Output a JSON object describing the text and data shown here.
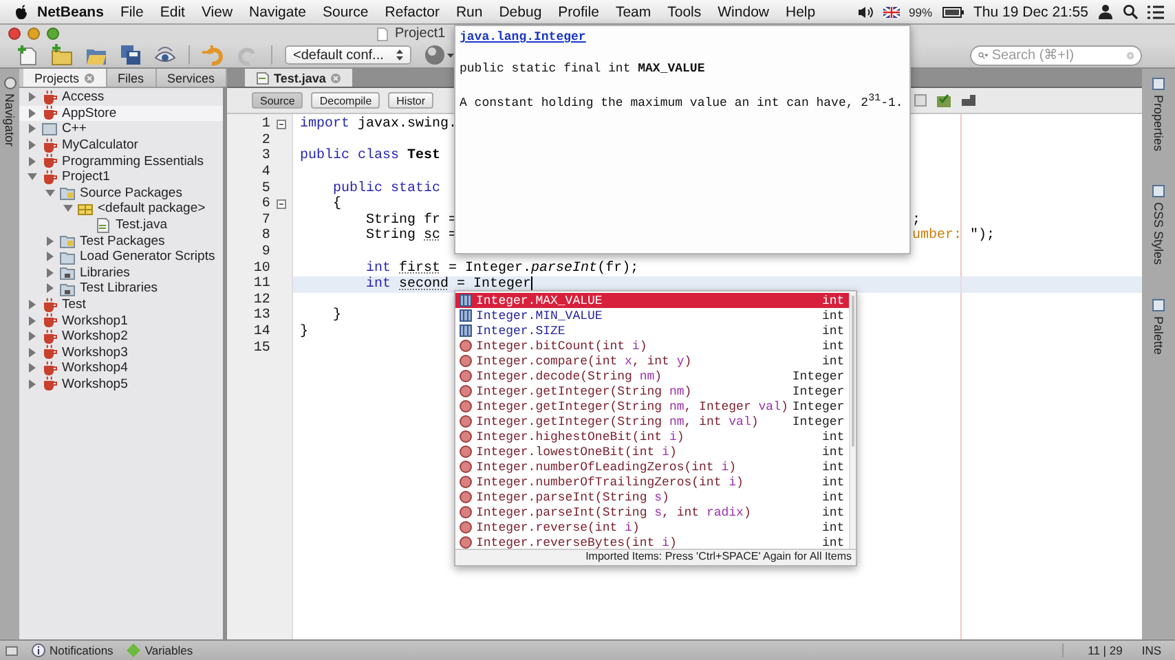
{
  "menu_bar": {
    "app": "NetBeans",
    "items": [
      "File",
      "Edit",
      "View",
      "Navigate",
      "Source",
      "Refactor",
      "Run",
      "Debug",
      "Profile",
      "Team",
      "Tools",
      "Window",
      "Help"
    ],
    "battery": "99%",
    "clock": "Thu 19 Dec  21:55"
  },
  "window": {
    "title": "Project1"
  },
  "toolbar": {
    "config": "<default conf...",
    "search": {
      "placeholder": "Search (⌘+I)"
    }
  },
  "side_strips": {
    "left": [
      "Navigator"
    ],
    "right": [
      "Properties",
      "CSS Styles",
      "Palette"
    ]
  },
  "projects_panel": {
    "tabs": [
      {
        "label": "Projects",
        "selected": true
      },
      {
        "label": "Files",
        "selected": false
      },
      {
        "label": "Services",
        "selected": false
      }
    ],
    "tree": [
      {
        "kind": "project",
        "label": "Access",
        "expanded": false,
        "selected": false
      },
      {
        "kind": "project",
        "label": "AppStore",
        "expanded": false,
        "selected": true
      },
      {
        "kind": "cpp",
        "label": "C++",
        "expanded": false,
        "selected": false
      },
      {
        "kind": "project",
        "label": "MyCalculator",
        "expanded": false,
        "selected": false
      },
      {
        "kind": "project",
        "label": "Programming Essentials",
        "expanded": false,
        "selected": false
      },
      {
        "kind": "project",
        "label": "Project1",
        "expanded": true,
        "selected": false,
        "children": [
          {
            "kind": "source",
            "label": "Source Packages",
            "expanded": true,
            "selected": false,
            "children": [
              {
                "kind": "package",
                "label": "<default package>",
                "expanded": true,
                "selected": false,
                "children": [
                  {
                    "kind": "java",
                    "label": "Test.java",
                    "selected": false
                  }
                ]
              }
            ]
          },
          {
            "kind": "source",
            "label": "Test Packages",
            "expanded": false,
            "selected": false
          },
          {
            "kind": "folder",
            "label": "Load Generator Scripts",
            "expanded": false,
            "selected": false
          },
          {
            "kind": "library",
            "label": "Libraries",
            "expanded": false,
            "selected": false
          },
          {
            "kind": "library",
            "label": "Test Libraries",
            "expanded": false,
            "selected": false
          }
        ]
      },
      {
        "kind": "project",
        "label": "Test",
        "expanded": false,
        "selected": false
      },
      {
        "kind": "project",
        "label": "Workshop1",
        "expanded": false,
        "selected": false
      },
      {
        "kind": "project",
        "label": "Workshop2",
        "expanded": false,
        "selected": false
      },
      {
        "kind": "project",
        "label": "Workshop3",
        "expanded": false,
        "selected": false
      },
      {
        "kind": "project",
        "label": "Workshop4",
        "expanded": false,
        "selected": false
      },
      {
        "kind": "project",
        "label": "Workshop5",
        "expanded": false,
        "selected": false
      }
    ]
  },
  "editor": {
    "tabs": [
      {
        "label": "Test.java",
        "selected": true
      }
    ],
    "views": [
      {
        "label": "Source",
        "selected": true
      },
      {
        "label": "Decompile",
        "selected": false
      },
      {
        "label": "Histor",
        "selected": false
      }
    ],
    "lines": [
      {
        "number": "1",
        "fold": true,
        "current": false,
        "parts": [
          {
            "kind": "kw",
            "text": "import"
          },
          {
            "kind": "plain",
            "text": " javax.swing."
          }
        ]
      },
      {
        "number": "2",
        "fold": false,
        "current": false
      },
      {
        "number": "3",
        "fold": false,
        "current": false,
        "parts": [
          {
            "kind": "kw",
            "text": "public class "
          },
          {
            "kind": "bold",
            "text": "Test"
          }
        ]
      },
      {
        "number": "4",
        "fold": false,
        "current": false
      },
      {
        "number": "5",
        "fold": false,
        "current": false,
        "parts": [
          {
            "kind": "kw",
            "text": "    public static"
          }
        ]
      },
      {
        "number": "6",
        "fold": true,
        "current": false,
        "parts": [
          {
            "kind": "plain",
            "text": "    {"
          }
        ]
      },
      {
        "number": "7",
        "fold": false,
        "current": false,
        "parts": [
          {
            "kind": "plain",
            "text": "        String fr ="
          }
        ],
        "tail": [
          {
            "kind": "plain",
            "text": ";"
          }
        ]
      },
      {
        "number": "8",
        "fold": false,
        "current": false,
        "parts": [
          {
            "kind": "plain",
            "text": "        String "
          },
          {
            "kind": "ul",
            "text": "sc"
          },
          {
            "kind": "plain",
            "text": " ="
          }
        ],
        "tail": [
          {
            "kind": "str",
            "text": "umber: "
          },
          {
            "kind": "plain",
            "text": "\");"
          }
        ]
      },
      {
        "number": "9",
        "fold": false,
        "current": false
      },
      {
        "number": "10",
        "fold": false,
        "current": false,
        "parts": [
          {
            "kind": "kw",
            "text": "        int "
          },
          {
            "kind": "ul",
            "text": "first"
          },
          {
            "kind": "plain",
            "text": " = Integer."
          },
          {
            "kind": "ital",
            "text": "parseInt"
          },
          {
            "kind": "plain",
            "text": "(fr);"
          }
        ]
      },
      {
        "number": "11",
        "fold": false,
        "current": true,
        "parts": [
          {
            "kind": "kw",
            "text": "        int "
          },
          {
            "kind": "ul",
            "text": "second"
          },
          {
            "kind": "plain",
            "text": " = Integer"
          }
        ]
      },
      {
        "number": "12",
        "fold": false,
        "current": false
      },
      {
        "number": "13",
        "fold": false,
        "current": false,
        "parts": [
          {
            "kind": "plain",
            "text": "    }"
          }
        ]
      },
      {
        "number": "14",
        "fold": false,
        "current": false,
        "parts": [
          {
            "kind": "plain",
            "text": "}"
          }
        ]
      },
      {
        "number": "15",
        "fold": false,
        "current": false
      }
    ]
  },
  "doc_popup": {
    "class_link": "java.lang.Integer",
    "signature": "public static final int **MAX_VALUE**",
    "description": "A constant holding the maximum value an int can have, 2$^{31}$-1."
  },
  "completion": {
    "items": [
      {
        "kind": "field",
        "selected": true,
        "segments": [
          "Integer.MAX_VALUE"
        ],
        "type": "int"
      },
      {
        "kind": "field",
        "selected": false,
        "segments": [
          "Integer.MIN_VALUE"
        ],
        "type": "int"
      },
      {
        "kind": "field",
        "selected": false,
        "segments": [
          "Integer.SIZE"
        ],
        "type": "int"
      },
      {
        "kind": "method",
        "selected": false,
        "segments": [
          "Integer.bitCount(int ",
          "i",
          ")"
        ],
        "type": "int"
      },
      {
        "kind": "method",
        "selected": false,
        "segments": [
          "Integer.compare(int ",
          "x",
          ", int ",
          "y",
          ")"
        ],
        "type": "int"
      },
      {
        "kind": "method",
        "selected": false,
        "segments": [
          "Integer.decode(String ",
          "nm",
          ")"
        ],
        "type": "Integer"
      },
      {
        "kind": "method",
        "selected": false,
        "segments": [
          "Integer.getInteger(String ",
          "nm",
          ")"
        ],
        "type": "Integer"
      },
      {
        "kind": "method",
        "selected": false,
        "segments": [
          "Integer.getInteger(String ",
          "nm",
          ", Integer ",
          "val",
          ")"
        ],
        "type": "Integer"
      },
      {
        "kind": "method",
        "selected": false,
        "segments": [
          "Integer.getInteger(String ",
          "nm",
          ", int ",
          "val",
          ")"
        ],
        "type": "Integer"
      },
      {
        "kind": "method",
        "selected": false,
        "segments": [
          "Integer.highestOneBit(int ",
          "i",
          ")"
        ],
        "type": "int"
      },
      {
        "kind": "method",
        "selected": false,
        "segments": [
          "Integer.lowestOneBit(int ",
          "i",
          ")"
        ],
        "type": "int"
      },
      {
        "kind": "method",
        "selected": false,
        "segments": [
          "Integer.numberOfLeadingZeros(int ",
          "i",
          ")"
        ],
        "type": "int"
      },
      {
        "kind": "method",
        "selected": false,
        "segments": [
          "Integer.numberOfTrailingZeros(int ",
          "i",
          ")"
        ],
        "type": "int"
      },
      {
        "kind": "method",
        "selected": false,
        "segments": [
          "Integer.parseInt(String ",
          "s",
          ")"
        ],
        "type": "int"
      },
      {
        "kind": "method",
        "selected": false,
        "segments": [
          "Integer.parseInt(String ",
          "s",
          ", int ",
          "radix",
          ")"
        ],
        "type": "int"
      },
      {
        "kind": "method",
        "selected": false,
        "segments": [
          "Integer.reverse(int ",
          "i",
          ")"
        ],
        "type": "int"
      },
      {
        "kind": "method",
        "selected": false,
        "segments": [
          "Integer.reverseBytes(int ",
          "i",
          ")"
        ],
        "type": "int"
      }
    ],
    "footer": "Imported Items: Press 'Ctrl+SPACE' Again for All Items"
  },
  "status_bar": {
    "items": [
      "Notifications",
      "Variables"
    ],
    "position": "11 | 29",
    "mode": "INS"
  }
}
